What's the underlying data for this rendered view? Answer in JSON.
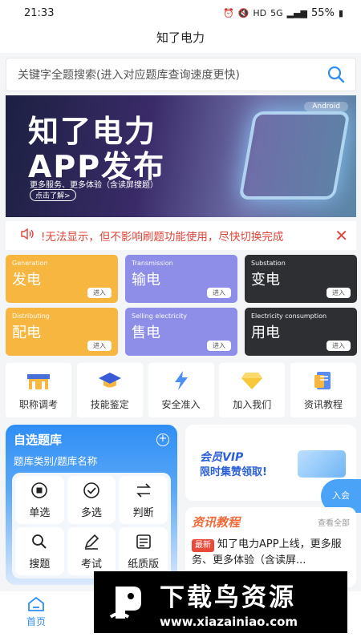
{
  "status": {
    "time": "21:33",
    "battery": "55%",
    "network": "5G",
    "hd": "HD"
  },
  "app": {
    "title": "知了电力"
  },
  "search": {
    "placeholder": "关键字全题搜索(进入对应题库查询速度更快)"
  },
  "banner": {
    "tag": "Android",
    "line1": "知了电力",
    "line2": "APP发布",
    "sub": "更多服务、更多体验（含读屏搜题）",
    "more": "点击了解>"
  },
  "notice": {
    "text": "!无法显示，但不影响刷题功能使用，尽快切换完成"
  },
  "tiles": [
    {
      "en": "Generation",
      "cn": "发电",
      "go": "进入",
      "color": "#f7b640"
    },
    {
      "en": "Transmission",
      "cn": "输电",
      "go": "进入",
      "color": "#8e8ee8"
    },
    {
      "en": "Substation",
      "cn": "变电",
      "go": "进入",
      "color": "#2d2f33"
    },
    {
      "en": "Distributing",
      "cn": "配电",
      "go": "进入",
      "color": "#f7b640"
    },
    {
      "en": "Selling electricity",
      "cn": "售电",
      "go": "进入",
      "color": "#8e8ee8"
    },
    {
      "en": "Electricity consumption",
      "cn": "用电",
      "go": "进入",
      "color": "#2d2f33"
    }
  ],
  "quick": [
    {
      "label": "职称调考",
      "icon": "building-icon"
    },
    {
      "label": "技能鉴定",
      "icon": "graduation-cap-icon"
    },
    {
      "label": "安全准入",
      "icon": "lightning-icon"
    },
    {
      "label": "加入我们",
      "icon": "diamond-icon"
    },
    {
      "label": "资讯教程",
      "icon": "document-icon"
    }
  ],
  "pick": {
    "title": "自选题库",
    "subtitle": "题库类别/题库名称",
    "buttons": [
      "单选",
      "多选",
      "判断",
      "搜题",
      "考试",
      "纸质版"
    ]
  },
  "vip": {
    "line1": "会员VIP",
    "line2": "限时集赞领取!",
    "join": "入会"
  },
  "news": {
    "title": "资讯教程",
    "all": "查看全部",
    "badge": "最新",
    "item": "知了电力APP上线，更多服务、更多体验（含读屏..."
  },
  "tabbar": {
    "home": "首页"
  },
  "watermark": {
    "brand": "下载鸟资源",
    "url": "www.xiazainiao.com"
  },
  "colors": {
    "accent": "#2f8ef5",
    "notice": "#e0453a",
    "orange": "#f7b640",
    "purple": "#8e8ee8",
    "dark": "#2d2f33"
  }
}
